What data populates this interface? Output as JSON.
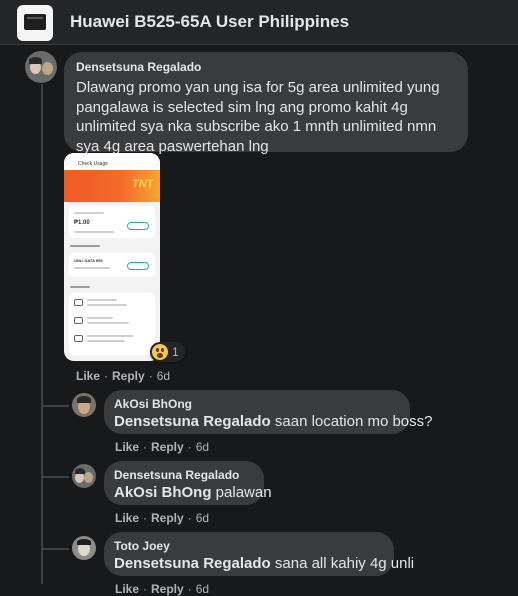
{
  "header": {
    "group_name": "Huawei B525-65A User Philippines"
  },
  "comments": [
    {
      "author": "Densetsuna Regalado",
      "text": "Dlawang promo yan ung isa for 5g area unlimited yung pangalawa is selected sim lng ang promo kahit 4g unlimited sya nka subscribe ako 1 mnth unlimited nmn sya 4g area paswertehan lng",
      "like": "Like",
      "reply": "Reply",
      "time": "6d",
      "reaction_count": "1"
    },
    {
      "author": "AkOsi BhOng",
      "mention": "Densetsuna Regalado",
      "text": " saan location mo boss?",
      "like": "Like",
      "reply": "Reply",
      "time": "6d"
    },
    {
      "author": "Densetsuna Regalado",
      "mention": "AkOsi BhOng",
      "text": " palawan",
      "like": "Like",
      "reply": "Reply",
      "time": "6d"
    },
    {
      "author": "Toto Joey",
      "mention": "Densetsuna Regalado",
      "text": " sana all kahiy 4g unli",
      "like": "Like",
      "reply": "Reply",
      "time": "6d"
    }
  ],
  "screenshot_attachment": {
    "title": "Check Usage",
    "brand_mark": "TNT",
    "balance": "₱1.00",
    "subscription": "UNLI DATA 599"
  },
  "colors": {
    "background": "#18191a",
    "bubble": "#3a3b3c",
    "header": "#242526",
    "text": "#e4e6eb",
    "muted": "#b0b3b8"
  }
}
